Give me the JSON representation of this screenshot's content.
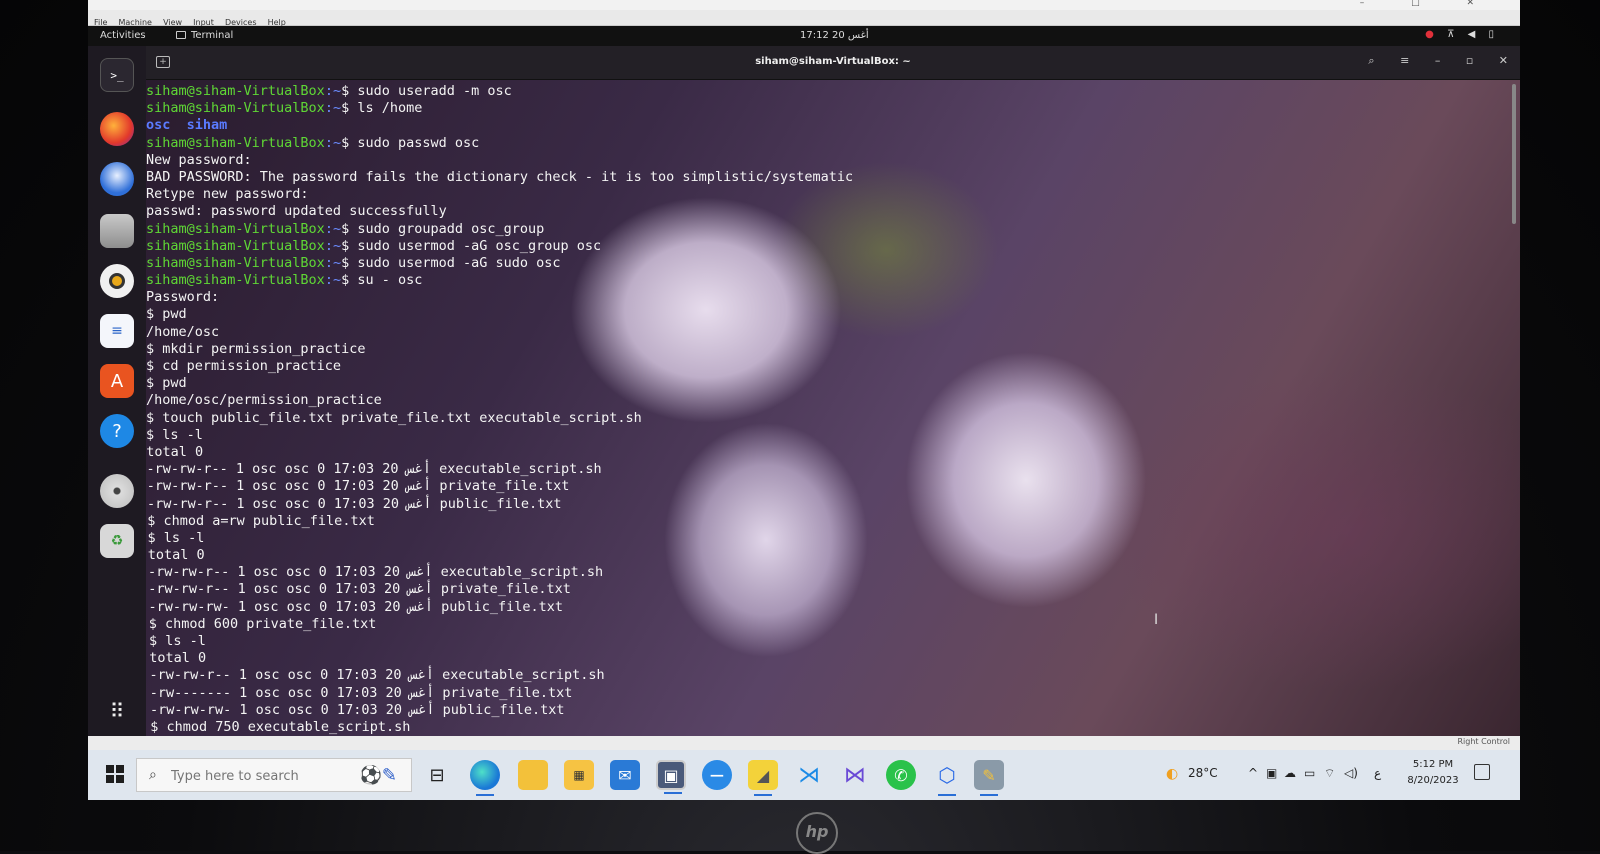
{
  "virtualbox": {
    "menu": [
      "File",
      "Machine",
      "View",
      "Input",
      "Devices",
      "Help"
    ],
    "status_right": "Right Control"
  },
  "gnome_top_bar": {
    "activities": "Activities",
    "app_name": "Terminal",
    "clock": "17:12 أغس 20"
  },
  "dock": {
    "items": [
      "terminal-icon",
      "firefox-icon",
      "thunderbird-icon",
      "files-icon",
      "rhythmbox-icon",
      "writer-icon",
      "software-icon",
      "help-icon",
      "disc-icon",
      "trash-icon",
      "app-grid-icon"
    ]
  },
  "terminal": {
    "title": "siham@siham-VirtualBox: ~",
    "prompt_user": "siham@siham-VirtualBox",
    "prompt_path": "~",
    "lines": [
      {
        "kind": "cmd",
        "text": "sudo useradd -m osc"
      },
      {
        "kind": "cmd",
        "text": "ls /home"
      },
      {
        "kind": "dirs",
        "text": "osc  siham"
      },
      {
        "kind": "cmd",
        "text": "sudo passwd osc"
      },
      {
        "kind": "out",
        "text": "New password:"
      },
      {
        "kind": "out",
        "text": "BAD PASSWORD: The password fails the dictionary check - it is too simplistic/systematic"
      },
      {
        "kind": "out",
        "text": "Retype new password:"
      },
      {
        "kind": "out",
        "text": "passwd: password updated successfully"
      },
      {
        "kind": "cmd",
        "text": "sudo groupadd osc_group"
      },
      {
        "kind": "cmd",
        "text": "sudo usermod -aG osc_group osc"
      },
      {
        "kind": "cmd",
        "text": "sudo usermod -aG sudo osc"
      },
      {
        "kind": "cmd",
        "text": "su - osc"
      },
      {
        "kind": "out",
        "text": "Password:"
      },
      {
        "kind": "out",
        "text": "$ pwd"
      },
      {
        "kind": "out",
        "text": "/home/osc"
      },
      {
        "kind": "out",
        "text": "$ mkdir permission_practice"
      },
      {
        "kind": "out",
        "text": "$ cd permission_practice"
      },
      {
        "kind": "out",
        "text": "$ pwd"
      },
      {
        "kind": "out",
        "text": "/home/osc/permission_practice"
      },
      {
        "kind": "out",
        "text": "$ touch public_file.txt private_file.txt executable_script.sh"
      },
      {
        "kind": "out",
        "text": "$ ls -l"
      },
      {
        "kind": "out",
        "text": "total 0"
      },
      {
        "kind": "out",
        "text": "-rw-rw-r-- 1 osc osc 0 17:03 20 أغس executable_script.sh"
      },
      {
        "kind": "out",
        "text": "-rw-rw-r-- 1 osc osc 0 17:03 20 أغس private_file.txt"
      },
      {
        "kind": "out",
        "text": "-rw-rw-r-- 1 osc osc 0 17:03 20 أغس public_file.txt"
      },
      {
        "kind": "out",
        "text": "$ chmod a=rw public_file.txt"
      },
      {
        "kind": "out",
        "text": "$ ls -l"
      },
      {
        "kind": "out",
        "text": "total 0"
      },
      {
        "kind": "out",
        "text": "-rw-rw-r-- 1 osc osc 0 17:03 20 أغس executable_script.sh"
      },
      {
        "kind": "out",
        "text": "-rw-rw-r-- 1 osc osc 0 17:03 20 أغس private_file.txt"
      },
      {
        "kind": "out",
        "text": "-rw-rw-rw- 1 osc osc 0 17:03 20 أغس public_file.txt"
      },
      {
        "kind": "out",
        "text": "$ chmod 600 private_file.txt"
      },
      {
        "kind": "out",
        "text": "$ ls -l"
      },
      {
        "kind": "out",
        "text": "total 0"
      },
      {
        "kind": "out",
        "text": "-rw-rw-r-- 1 osc osc 0 17:03 20 أغس executable_script.sh"
      },
      {
        "kind": "out",
        "text": "-rw------- 1 osc osc 0 17:03 20 أغس private_file.txt"
      },
      {
        "kind": "out",
        "text": "-rw-rw-rw- 1 osc osc 0 17:03 20 أغس public_file.txt"
      },
      {
        "kind": "out",
        "text": "$ chmod 750 executable_script.sh"
      }
    ]
  },
  "windows_taskbar": {
    "search_placeholder": "Type here to search",
    "pinned": [
      "task-view-icon",
      "edge-icon",
      "file-explorer-icon",
      "store-icon",
      "mail-icon",
      "virtualbox-icon",
      "minus-app-icon",
      "sticky-notes-icon",
      "vscode-icon",
      "visual-studio-icon",
      "whatsapp-icon",
      "cube-app-icon",
      "paint-app-icon"
    ],
    "weather": "28°C",
    "language": "ع",
    "time": "5:12 PM",
    "date": "8/20/2023"
  },
  "colors": {
    "prompt_user": "#5fd735",
    "prompt_path": "#6b8cff",
    "taskbar": "#dfe6ee",
    "dock": "#1e1a22"
  }
}
